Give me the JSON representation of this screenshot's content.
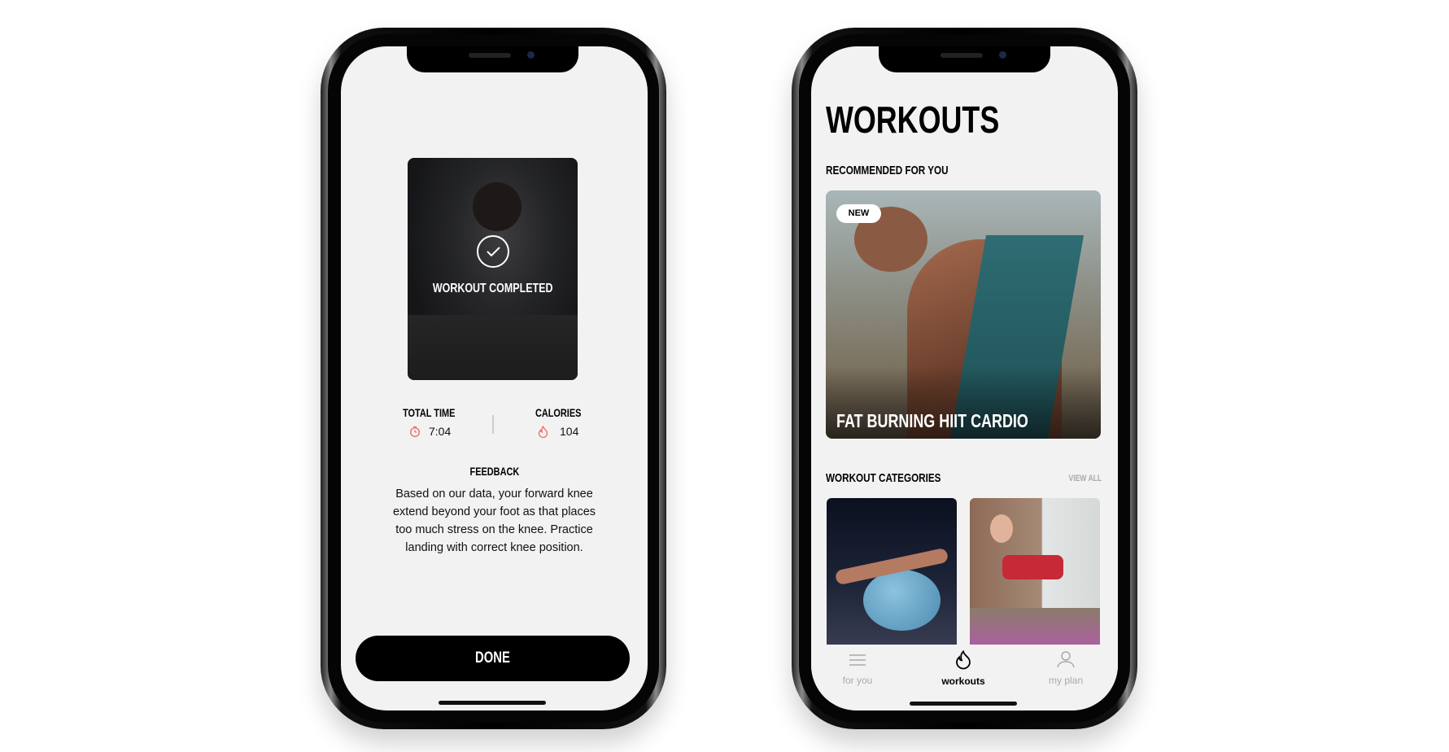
{
  "left_screen": {
    "overlay_text": "WORKOUT COMPLETED",
    "stats": [
      {
        "label": "TOTAL TIME",
        "value": "7:04",
        "icon": "stopwatch-icon"
      },
      {
        "label": "CALORIES",
        "value": "104",
        "icon": "flame-icon"
      }
    ],
    "feedback_title": "FEEDBACK",
    "feedback_lines": [
      "Based on our data,  your forward knee",
      "extend beyond your foot as that places",
      "too much stress on the knee. Practice",
      "landing with correct knee position."
    ],
    "done_label": "DONE",
    "accent": "#f06b6b"
  },
  "right_screen": {
    "title": "WORKOUTS",
    "recommended_heading": "RECOMMENDED FOR YOU",
    "hero": {
      "badge": "NEW",
      "title": "FAT BURNING HIIT CARDIO"
    },
    "categories_heading": "WORKOUT CATEGORIES",
    "view_all": "VIEW ALL",
    "tabs": [
      {
        "label": "for you",
        "icon": "menu-icon",
        "active": false
      },
      {
        "label": "workouts",
        "icon": "flame-icon",
        "active": true
      },
      {
        "label": "my plan",
        "icon": "user-icon",
        "active": false
      }
    ]
  }
}
